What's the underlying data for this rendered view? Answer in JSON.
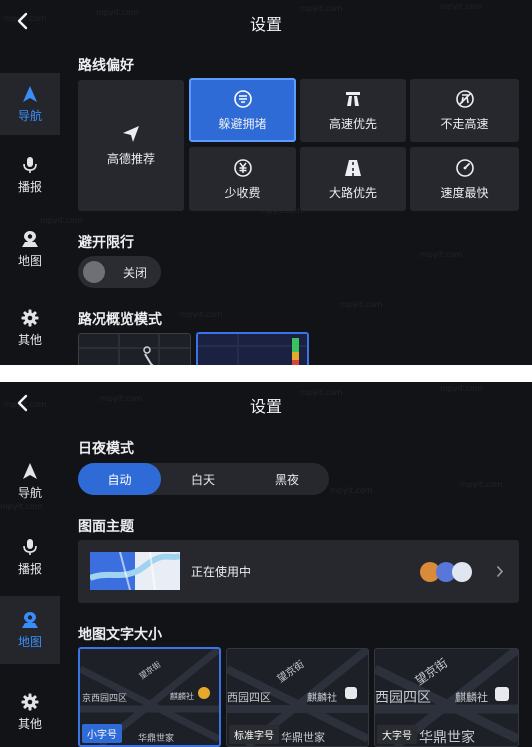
{
  "watermark_text": "mpyit.com",
  "screen1": {
    "title": "设置",
    "sidebar": [
      {
        "label": "导航",
        "icon": "navigation-arrow-icon",
        "active": true
      },
      {
        "label": "播报",
        "icon": "microphone-icon",
        "active": false
      },
      {
        "label": "地图",
        "icon": "map-pin-icon",
        "active": false
      },
      {
        "label": "其他",
        "icon": "gear-icon",
        "active": false
      }
    ],
    "route_pref": {
      "title": "路线偏好",
      "recommend": "高德推荐",
      "options": [
        {
          "label": "躲避拥堵",
          "icon": "avoid-congestion-icon",
          "selected": true
        },
        {
          "label": "高速优先",
          "icon": "highway-icon",
          "selected": false
        },
        {
          "label": "不走高速",
          "icon": "no-highway-icon",
          "selected": false
        },
        {
          "label": "少收费",
          "icon": "less-toll-icon",
          "selected": false
        },
        {
          "label": "大路优先",
          "icon": "main-road-icon",
          "selected": false
        },
        {
          "label": "速度最快",
          "icon": "speedometer-icon",
          "selected": false
        }
      ]
    },
    "avoid_limit": {
      "title": "避开限行",
      "toggle_label": "关闭"
    },
    "traffic_overview": {
      "title": "路况概览模式"
    }
  },
  "screen2": {
    "title": "设置",
    "sidebar": [
      {
        "label": "导航",
        "icon": "navigation-arrow-icon",
        "active": false
      },
      {
        "label": "播报",
        "icon": "microphone-icon",
        "active": false
      },
      {
        "label": "地图",
        "icon": "map-pin-icon",
        "active": true
      },
      {
        "label": "其他",
        "icon": "gear-icon",
        "active": false
      }
    ],
    "day_night": {
      "title": "日夜模式",
      "options": [
        {
          "label": "自动",
          "selected": true
        },
        {
          "label": "白天",
          "selected": false
        },
        {
          "label": "黑夜",
          "selected": false
        }
      ]
    },
    "theme": {
      "title": "图面主题",
      "status": "正在使用中"
    },
    "font_size": {
      "title": "地图文字大小",
      "options": [
        {
          "tag": "小字号",
          "street": "望京街",
          "district": "京西园四区",
          "poi": "麒麟社",
          "place": "华鼎世家",
          "selected": true
        },
        {
          "tag": "标准字号",
          "street": "望京街",
          "district": "西园四区",
          "poi": "麒麟社",
          "place": "华鼎世家",
          "selected": false
        },
        {
          "tag": "大字号",
          "street": "望京街",
          "district": "西园四区",
          "poi": "麒麟社",
          "place": "华鼎世家",
          "selected": false
        }
      ]
    }
  },
  "colors": {
    "accent": "#2e6bd7",
    "accent_border": "#5d9bff",
    "active_text": "#3a8df8",
    "background": "#121316",
    "card": "#26282e"
  }
}
